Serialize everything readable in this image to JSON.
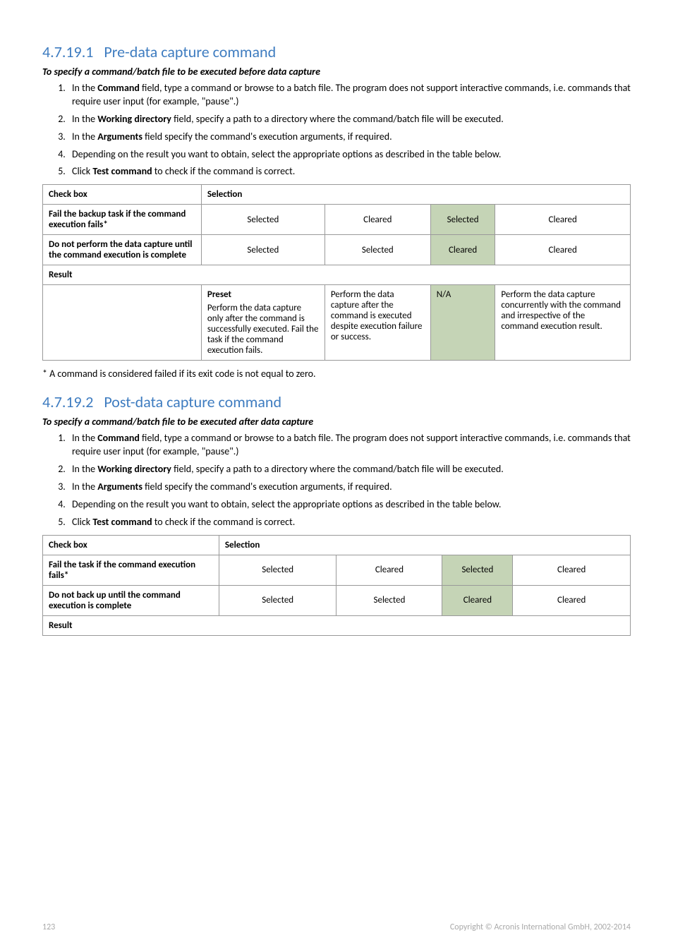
{
  "section1": {
    "number": "4.7.19.1",
    "title": "Pre-data capture command",
    "subhead": "To specify a command/batch file to be executed before data capture",
    "steps_prefix": [
      "In the ",
      "In the ",
      "In the ",
      "Depending on the result you want to obtain, select the appropriate options as described in the table below.",
      "Click "
    ],
    "steps_bold": [
      "Command",
      "Working directory",
      "Arguments",
      "",
      "Test command"
    ],
    "steps_suffix": [
      " field, type a command or browse to a batch file. The program does not support interactive commands, i.e. commands that require user input (for example, \"pause\".)",
      " field, specify a path to a directory where the command/batch file will be executed.",
      " field specify the command's execution arguments, if required.",
      "",
      " to check if the command is correct."
    ],
    "table": {
      "header_checkbox": "Check box",
      "header_selection": "Selection",
      "row1_label": "Fail the backup task if the command execution fails*",
      "row1_cells": [
        "Selected",
        "Cleared",
        "Selected",
        "Cleared"
      ],
      "row2_label": "Do not perform the data capture until the command execution is complete",
      "row2_cells": [
        "Selected",
        "Selected",
        "Cleared",
        "Cleared"
      ],
      "result_label": "Result",
      "preset_label": "Preset",
      "preset_body": "Perform the data capture only after the command is successfully executed. Fail the task if the command execution fails.",
      "col2": "Perform the data capture after the command is executed despite execution failure or success.",
      "col3": "N/A",
      "col4": "Perform the data capture concurrently with the command and irrespective of the command execution result."
    },
    "footnote": "* A command is considered failed if its exit code is not equal to zero."
  },
  "section2": {
    "number": "4.7.19.2",
    "title": "Post-data capture command",
    "subhead": "To specify a command/batch file to be executed after data capture",
    "steps_prefix": [
      "In the ",
      "In the ",
      "In the ",
      "Depending on the result you want to obtain, select the appropriate options as described in the table below.",
      "Click "
    ],
    "steps_bold": [
      "Command",
      "Working directory",
      "Arguments",
      "",
      "Test command"
    ],
    "steps_suffix": [
      " field, type a command or browse to a batch file. The program does not support interactive commands, i.e. commands that require user input (for example, \"pause\".)",
      " field, specify a path to a directory where the command/batch file will be executed.",
      " field specify the command's execution arguments, if required.",
      "",
      " to check if the command is correct."
    ],
    "table": {
      "header_checkbox": "Check box",
      "header_selection": "Selection",
      "row1_label": "Fail the task if the command execution fails*",
      "row1_cells": [
        "Selected",
        "Cleared",
        "Selected",
        "Cleared"
      ],
      "row2_label": "Do not back up until the command execution is complete",
      "row2_cells": [
        "Selected",
        "Selected",
        "Cleared",
        "Cleared"
      ],
      "result_label": "Result"
    }
  },
  "footer": {
    "page": "123",
    "copyright": "Copyright © Acronis International GmbH, 2002-2014"
  }
}
